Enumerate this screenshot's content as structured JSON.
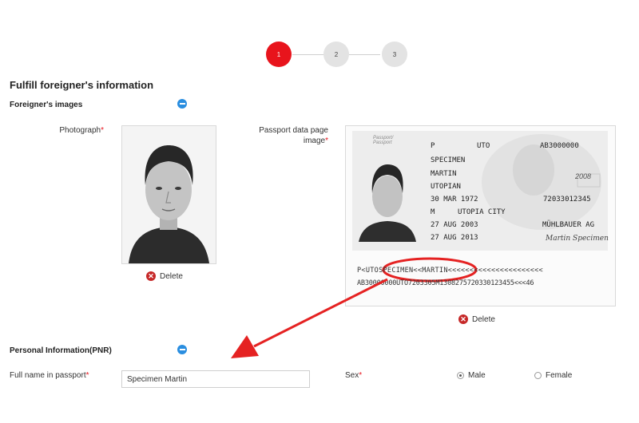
{
  "stepper": {
    "steps": [
      "1",
      "2",
      "3"
    ],
    "active_index": 0
  },
  "page_title": "Fulfill foreigner's information",
  "images_section": {
    "heading": "Foreigner's images"
  },
  "photograph": {
    "label": "Photograph",
    "required_mark": "*",
    "delete_label": "Delete"
  },
  "passport_page": {
    "label_line1": "Passport data page",
    "label_line2": "image",
    "required_mark": "*",
    "delete_label": "Delete",
    "document": {
      "doc_label": "Passport/\nPassport",
      "type": "P",
      "country": "UTO",
      "number": "AB3000000",
      "surname": "SPECIMEN",
      "given_names": "MARTIN",
      "nationality": "UTOPIAN",
      "birth_date": "30 MAR 1972",
      "personal_no": "72033012345",
      "sex": "M",
      "place_of_birth": "UTOPIA CITY",
      "issue_date": "27 AUG 2003",
      "authority": "MÜHLBAUER AG",
      "expiry_date": "27 AUG 2013",
      "signature": "Martin Specimen",
      "year_stamp": "2008",
      "mrz_line1": "P<UTOSPECIMEN<<MARTIN<<<<<<<<<<<<<<<<<<<<<<",
      "mrz_line2": "AB30000000UTO7203305M1308275720330123455<<<46"
    }
  },
  "personal_section": {
    "heading": "Personal Information(PNR)"
  },
  "full_name": {
    "label": "Full name in passport",
    "required_mark": "*",
    "value": "Specimen Martin"
  },
  "sex": {
    "label": "Sex",
    "required_mark": "*",
    "options": [
      "Male",
      "Female"
    ],
    "selected": "Male"
  },
  "colors": {
    "accent_red": "#e8141c",
    "info_blue": "#2a8ee0",
    "annotation_red": "#e52222"
  }
}
